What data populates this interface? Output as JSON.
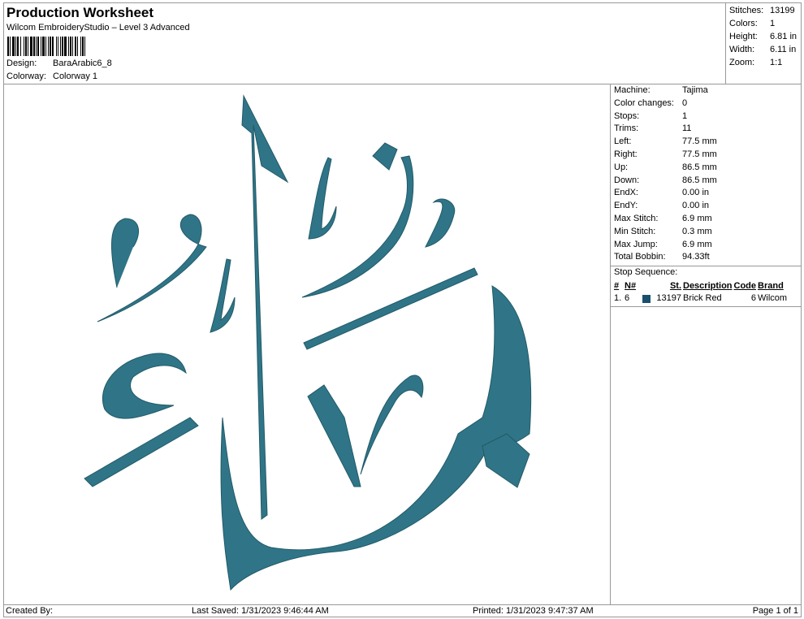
{
  "header": {
    "title": "Production Worksheet",
    "subtitle": "Wilcom EmbroideryStudio – Level 3 Advanced",
    "design_label": "Design:",
    "design_value": "BaraArabic6_8",
    "colorway_label": "Colorway:",
    "colorway_value": "Colorway 1"
  },
  "stats": [
    {
      "k": "Stitches:",
      "v": "13199"
    },
    {
      "k": "Colors:",
      "v": "1"
    },
    {
      "k": "Height:",
      "v": "6.81 in"
    },
    {
      "k": "Width:",
      "v": "6.11 in"
    },
    {
      "k": "Zoom:",
      "v": "1:1"
    }
  ],
  "machine": [
    {
      "k": "Machine:",
      "v": "Tajima"
    },
    {
      "k": "Color changes:",
      "v": "0"
    },
    {
      "k": "Stops:",
      "v": "1"
    },
    {
      "k": "Trims:",
      "v": "11"
    },
    {
      "k": "Left:",
      "v": "77.5 mm"
    },
    {
      "k": "Right:",
      "v": "77.5 mm"
    },
    {
      "k": "Up:",
      "v": "86.5 mm"
    },
    {
      "k": "Down:",
      "v": "86.5 mm"
    },
    {
      "k": "EndX:",
      "v": "0.00 in"
    },
    {
      "k": "EndY:",
      "v": "0.00 in"
    },
    {
      "k": "Max Stitch:",
      "v": "6.9 mm"
    },
    {
      "k": "Min Stitch:",
      "v": "0.3 mm"
    },
    {
      "k": "Max Jump:",
      "v": "6.9 mm"
    },
    {
      "k": "Total Bobbin:",
      "v": "94.33ft"
    }
  ],
  "stop_sequence": {
    "title": "Stop Sequence:",
    "headers": [
      "#",
      "N#",
      "St.",
      "Description",
      "Code",
      "Brand"
    ],
    "rows": [
      {
        "num": "1.",
        "n": "6",
        "color": "#1b4f6e",
        "st": "13197",
        "desc": "Brick Red",
        "code": "6",
        "brand": "Wilcom"
      }
    ]
  },
  "design_color": "#2f7587",
  "footer": {
    "created": "Created By:",
    "saved": "Last Saved: 1/31/2023 9:46:44 AM",
    "printed": "Printed: 1/31/2023 9:47:37 AM",
    "page": "Page 1 of 1"
  }
}
